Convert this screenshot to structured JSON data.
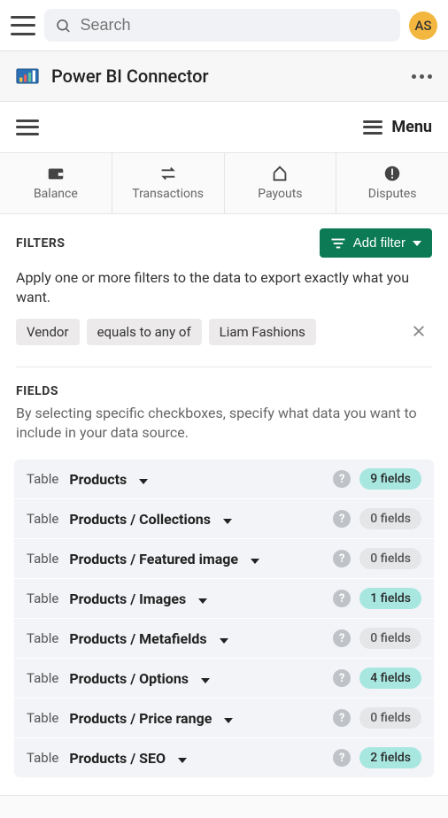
{
  "top": {
    "search_placeholder": "Search",
    "avatar_initials": "AS"
  },
  "appHeader": {
    "title": "Power BI Connector"
  },
  "innerMenu": {
    "menu_label": "Menu"
  },
  "tabs": [
    {
      "label": "Balance"
    },
    {
      "label": "Transactions"
    },
    {
      "label": "Payouts"
    },
    {
      "label": "Disputes"
    }
  ],
  "filters": {
    "title": "FILTERS",
    "add_label": "Add filter",
    "description": "Apply one or more filters to the data to export exactly what you want.",
    "chips": [
      "Vendor",
      "equals to any of",
      "Liam Fashions"
    ]
  },
  "fields": {
    "title": "FIELDS",
    "description": "By selecting specific checkboxes, specify what data you want to include in your data source.",
    "prefix": "Table",
    "tables": [
      {
        "name": "Products",
        "count": 9
      },
      {
        "name": "Products / Collections",
        "count": 0
      },
      {
        "name": "Products / Featured image",
        "count": 0
      },
      {
        "name": "Products / Images",
        "count": 1
      },
      {
        "name": "Products / Metafields",
        "count": 0
      },
      {
        "name": "Products / Options",
        "count": 4
      },
      {
        "name": "Products / Price range",
        "count": 0
      },
      {
        "name": "Products / SEO",
        "count": 2
      }
    ],
    "badge_suffix": "fields"
  }
}
